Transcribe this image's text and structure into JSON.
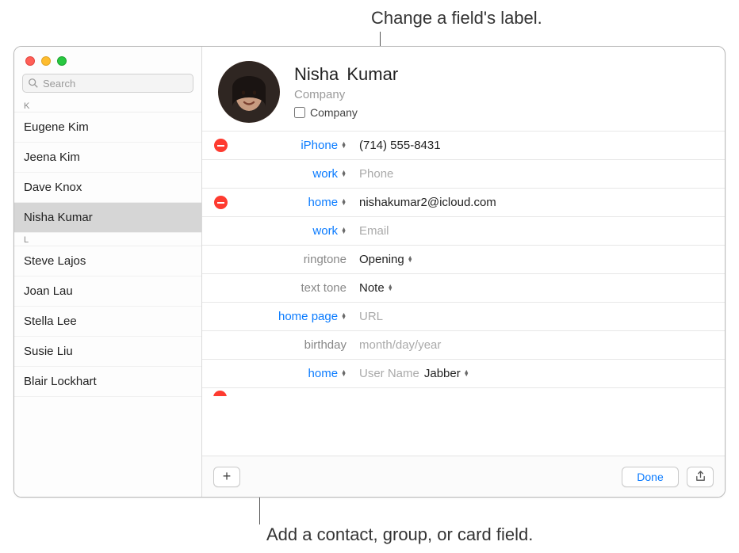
{
  "callouts": {
    "top": "Change a field's label.",
    "bottom": "Add a contact, group, or card field."
  },
  "sidebar": {
    "search_placeholder": "Search",
    "sections": [
      {
        "letter": "K",
        "items": [
          "Eugene Kim",
          "Jeena Kim",
          "Dave Knox",
          "Nisha Kumar"
        ],
        "selected": "Nisha Kumar"
      },
      {
        "letter": "L",
        "items": [
          "Steve Lajos",
          "Joan Lau",
          "Stella Lee",
          "Susie Liu",
          "Blair Lockhart"
        ],
        "selected": null
      }
    ]
  },
  "detail": {
    "name": {
      "first": "Nisha",
      "last": "Kumar"
    },
    "company_placeholder": "Company",
    "company_checkbox_label": "Company",
    "fields": [
      {
        "remove": true,
        "label": "iPhone",
        "label_style": "blue",
        "label_select": true,
        "value": "(714) 555-8431",
        "placeholder": null
      },
      {
        "remove": false,
        "label": "work",
        "label_style": "blue",
        "label_select": true,
        "value": null,
        "placeholder": "Phone"
      },
      {
        "remove": true,
        "label": "home",
        "label_style": "blue",
        "label_select": true,
        "value": "nishakumar2@icloud.com",
        "placeholder": null
      },
      {
        "remove": false,
        "label": "work",
        "label_style": "blue",
        "label_select": true,
        "value": null,
        "placeholder": "Email"
      },
      {
        "remove": false,
        "label": "ringtone",
        "label_style": "grey",
        "label_select": false,
        "value_select": "Opening"
      },
      {
        "remove": false,
        "label": "text tone",
        "label_style": "grey",
        "label_select": false,
        "value_select": "Note"
      },
      {
        "remove": false,
        "label": "home page",
        "label_style": "blue",
        "label_select": true,
        "value": null,
        "placeholder": "URL"
      },
      {
        "remove": false,
        "label": "birthday",
        "label_style": "grey",
        "label_select": false,
        "value": null,
        "placeholder": "month/day/year"
      },
      {
        "remove": false,
        "label": "home",
        "label_style": "blue",
        "label_select": true,
        "value": null,
        "placeholder": "User Name",
        "extra_select": "Jabber"
      }
    ]
  },
  "footer": {
    "add_glyph": "+",
    "done_label": "Done"
  }
}
